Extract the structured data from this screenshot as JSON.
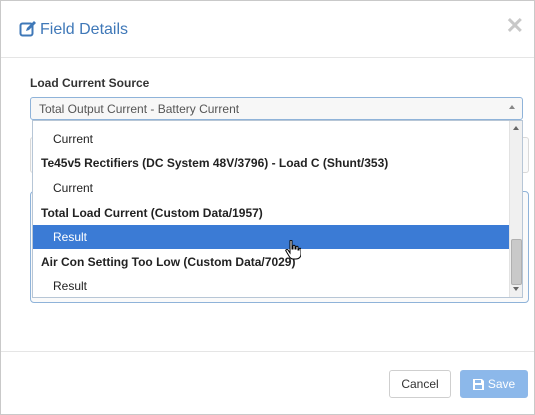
{
  "modal": {
    "title": "Field Details",
    "title_icon": "edit-icon",
    "close_icon": "close-icon"
  },
  "form": {
    "label": "Load Current Source",
    "selected_value": "Total Output Current - Battery Current"
  },
  "dropdown": {
    "options": [
      {
        "label": "Current",
        "type": "item"
      },
      {
        "label": "Te45v5 Rectifiers (DC System 48V/3796) - Load C (Shunt/353)",
        "type": "group"
      },
      {
        "label": "Current",
        "type": "item"
      },
      {
        "label": "Total Load Current (Custom Data/1957)",
        "type": "group"
      },
      {
        "label": "Result",
        "type": "item",
        "selected": true
      },
      {
        "label": "Air Con Setting Too Low (Custom Data/7029)",
        "type": "group"
      },
      {
        "label": "Result",
        "type": "item"
      }
    ]
  },
  "footer": {
    "cancel_label": "Cancel",
    "save_label": "Save"
  },
  "colors": {
    "accent": "#3f78b8",
    "selected": "#3b7bd5",
    "save_button": "#8cb8ea"
  }
}
